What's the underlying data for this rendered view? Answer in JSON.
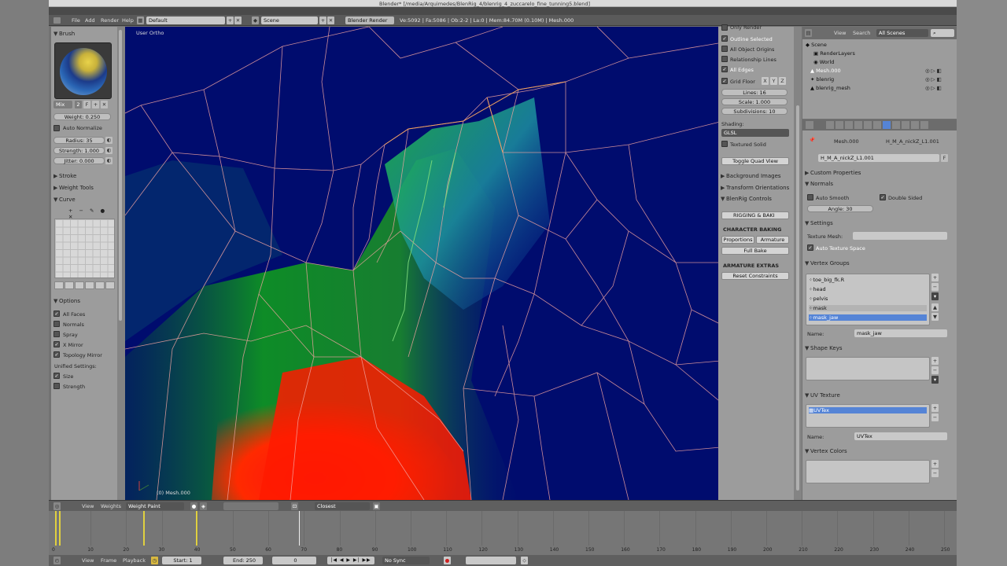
{
  "window": {
    "title": "Blender* [/media/Arquimedes/BlenRig_4/blenrig_4_zuccarelo_fine_tunning5.blend]"
  },
  "menubar": {
    "items": [
      "File",
      "Add",
      "Render",
      "Help"
    ],
    "layout": "Default",
    "scene": "Scene",
    "engine": "Blender Render",
    "stats": "Ve:5092 | Fa:5086 | Ob:2-2 | La:0 | Mem:84.70M (0.10M) | Mesh.000"
  },
  "tool_panel": {
    "brush_header": "Brush",
    "brush_mode": "Mix",
    "brush_num": "2",
    "brush_f": "F",
    "weight": "Weight: 0.250",
    "auto_normalize": "Auto Normalize",
    "radius": "Radius: 35",
    "strength": "Strength: 1.000",
    "jitter": "Jitter: 0.000",
    "stroke": "Stroke",
    "weight_tools": "Weight Tools",
    "curve": "Curve",
    "options": "Options",
    "all_faces": "All Faces",
    "normals": "Normals",
    "spray": "Spray",
    "x_mirror": "X Mirror",
    "topology_mirror": "Topology Mirror",
    "unified": "Unified Settings:",
    "size": "Size",
    "strength_opt": "Strength"
  },
  "viewport": {
    "view_label": "User Ortho",
    "object_label": "(0) Mesh.000"
  },
  "npanel": {
    "only_render": "Only Render",
    "outline_selected": "Outline Selected",
    "all_object_origins": "All Object Origins",
    "relationship_lines": "Relationship Lines",
    "all_edges": "All Edges",
    "grid_floor": "Grid Floor",
    "axis_x": "X",
    "axis_y": "Y",
    "axis_z": "Z",
    "lines": "Lines: 16",
    "scale": "Scale: 1.000",
    "subdivisions": "Subdivisions: 10",
    "shading": "Shading:",
    "shading_mode": "GLSL",
    "textured_solid": "Textured Solid",
    "toggle_quad": "Toggle Quad View",
    "background_images": "Background Images",
    "transform_orientations": "Transform Orientations",
    "blenrig_controls": "BlenRig Controls",
    "rigging_baking": "RIGGING & BAKI",
    "character_baking": "CHARACTER BAKING",
    "proportions": "Proportions",
    "armature": "Armature",
    "full_bake": "Full Bake",
    "armature_extras": "ARMATURE EXTRAS",
    "reset_constraints": "Reset Constraints"
  },
  "outliner": {
    "view": "View",
    "search": "Search",
    "filter": "All Scenes",
    "items": [
      "Scene",
      "RenderLayers",
      "World",
      "Mesh.000",
      "blenrig",
      "blenrig_mesh"
    ]
  },
  "properties": {
    "breadcrumb_mesh": "Mesh.000",
    "breadcrumb_data": "H_M_A_nickZ_L1.001",
    "datablock": "H_M_A_nickZ_L1.001",
    "datablock_f": "F",
    "custom_properties": "Custom Properties",
    "normals": "Normals",
    "auto_smooth": "Auto Smooth",
    "double_sided": "Double Sided",
    "angle": "Angle: 30",
    "settings": "Settings",
    "texture_mesh": "Texture Mesh:",
    "auto_texture_space": "Auto Texture Space",
    "vertex_groups": "Vertex Groups",
    "groups": [
      "toe_big_fk.R",
      "head",
      "pelvis",
      "mask",
      "mask_jaw"
    ],
    "selected_group": "mask_jaw",
    "name_label": "Name:",
    "name_value": "mask_jaw",
    "shape_keys": "Shape Keys",
    "uv_texture": "UV Texture",
    "uv_item": "UVTex",
    "uv_name_label": "Name:",
    "uv_name_value": "UVTex",
    "vertex_colors": "Vertex Colors"
  },
  "viewport_header": {
    "view": "View",
    "weights": "Weights",
    "mode": "Weight Paint",
    "snap": "Closest"
  },
  "timeline": {
    "ticks": [
      "0",
      "10",
      "20",
      "30",
      "40",
      "50",
      "60",
      "70",
      "80",
      "90",
      "100",
      "110",
      "120",
      "130",
      "140",
      "150",
      "160",
      "170",
      "180",
      "190",
      "200",
      "210",
      "220",
      "230",
      "240",
      "250"
    ],
    "current_frame": "0"
  },
  "timeline_footer": {
    "view": "View",
    "frame": "Frame",
    "playback": "Playback",
    "start": "Start: 1",
    "end": "End: 250",
    "current": "0",
    "sync": "No Sync"
  },
  "colors": {
    "viewport_bg": "#000c6e",
    "selection": "#5584d6",
    "panel": "#9c9c9c"
  }
}
